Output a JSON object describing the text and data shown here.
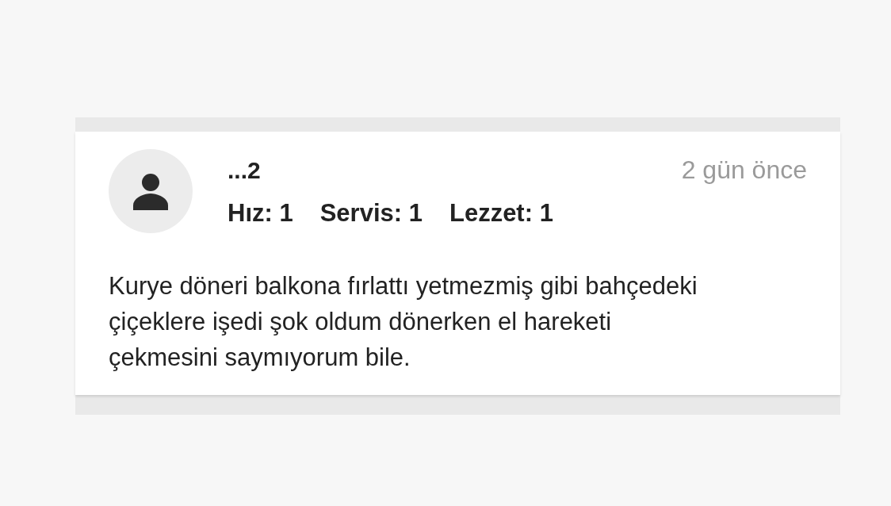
{
  "review": {
    "reviewer": "...2",
    "time": "2 gün önce",
    "ratings": [
      {
        "label": "Hız: 1"
      },
      {
        "label": "Servis: 1"
      },
      {
        "label": "Lezzet: 1"
      }
    ],
    "comment": "Kurye döneri balkona fırlattı yetmezmiş gibi bahçedeki çiçeklere işedi şok oldum dönerken el hareketi çekmesini saymıyorum bile."
  }
}
